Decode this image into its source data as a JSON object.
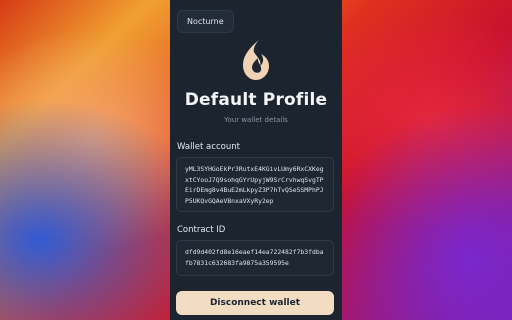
{
  "network": {
    "label": "Nocturne"
  },
  "profile": {
    "title": "Default Profile",
    "subtitle": "Your wallet details",
    "logo_icon": "flame-drop-icon"
  },
  "wallet": {
    "label": "Wallet account",
    "address": "yML3SYHGoEkPr3RutxE4KGivLUmy6RxCXKegxtCYooJ7Q9sohqGYrUpyjW9SrCrvhwqSvgTPEirDEmg8v4BuE2mLkpyZ3P7hTvQSe5SMPhPJP5UKQvGQAeVBnxaVXyRy2ep"
  },
  "contract": {
    "label": "Contract ID",
    "id": "dfd9d402fd8e16eaef14ea722482f7b3fdbafb7831c632683fa9875a359595e"
  },
  "actions": {
    "disconnect_label": "Disconnect wallet"
  },
  "colors": {
    "panel": "#1c2430",
    "accent_button": "#f2dcc2",
    "logo": "#f0d2b4"
  }
}
